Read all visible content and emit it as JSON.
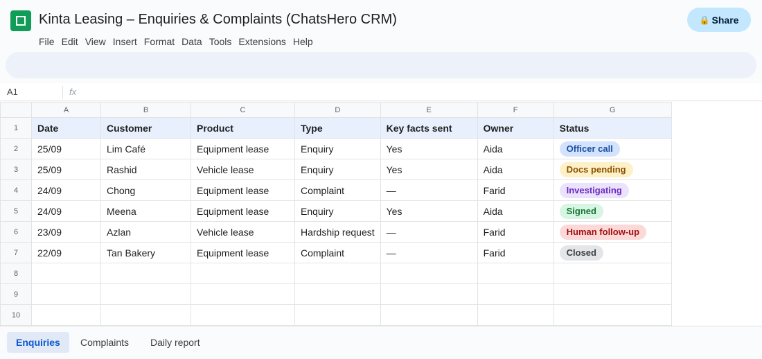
{
  "app": {
    "title": "Kinta Leasing – Enquiries & Complaints (ChatsHero CRM)",
    "share_label": "Share",
    "share_icon": "lock-icon"
  },
  "menu": [
    "File",
    "Edit",
    "View",
    "Insert",
    "Format",
    "Data",
    "Tools",
    "Extensions",
    "Help"
  ],
  "formula_bar": {
    "cell_ref": "A1",
    "fx_label": "fx"
  },
  "columns": [
    "A",
    "B",
    "C",
    "D",
    "E",
    "F",
    "G"
  ],
  "row_numbers": [
    "1",
    "2",
    "3",
    "4",
    "5",
    "6",
    "7",
    "8",
    "9",
    "10"
  ],
  "headers": [
    "Date",
    "Customer",
    "Product",
    "Type",
    "Key facts sent",
    "Owner",
    "Status"
  ],
  "rows": [
    [
      "25/09",
      "Lim Café",
      "Equipment lease",
      "Enquiry",
      "Yes",
      "Aida",
      "Officer call"
    ],
    [
      "25/09",
      "Rashid",
      "Vehicle lease",
      "Enquiry",
      "Yes",
      "Aida",
      "Docs pending"
    ],
    [
      "24/09",
      "Chong",
      "Equipment lease",
      "Complaint",
      "—",
      "Farid",
      "Investigating"
    ],
    [
      "24/09",
      "Meena",
      "Equipment lease",
      "Enquiry",
      "Yes",
      "Aida",
      "Signed"
    ],
    [
      "23/09",
      "Azlan",
      "Vehicle lease",
      "Hardship request",
      "—",
      "Farid",
      "Human follow-up"
    ],
    [
      "22/09",
      "Tan Bakery",
      "Equipment lease",
      "Complaint",
      "—",
      "Farid",
      "Closed"
    ]
  ],
  "status_colors": {
    "Officer call": "blue",
    "Docs pending": "yellow",
    "Investigating": "purple",
    "Signed": "green",
    "Human follow-up": "red",
    "Closed": "gray"
  },
  "sheet_tabs": [
    "Enquiries",
    "Complaints",
    "Daily report"
  ],
  "active_tab": "Enquiries",
  "colors": {
    "brand": "#0f9d58",
    "share_bg": "#c2e7ff",
    "header_row_bg": "#e8f0fe",
    "active_tab": "#0b57d0"
  }
}
